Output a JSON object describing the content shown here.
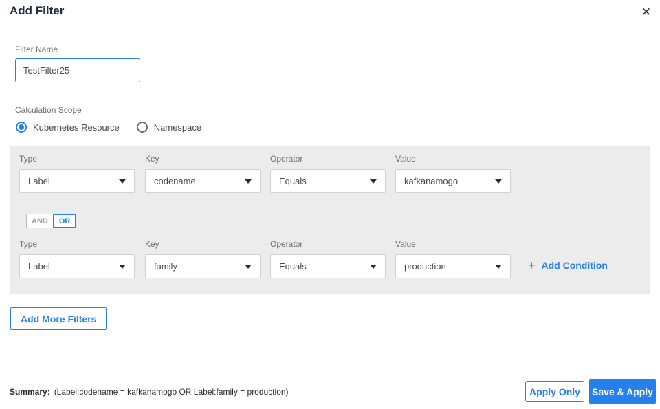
{
  "dialog": {
    "title": "Add Filter"
  },
  "filter_name": {
    "label": "Filter Name",
    "value": "TestFilter25"
  },
  "calculation_scope": {
    "label": "Calculation Scope",
    "options": [
      {
        "label": "Kubernetes Resource",
        "selected": true
      },
      {
        "label": "Namespace",
        "selected": false
      }
    ]
  },
  "conditions": {
    "columns": [
      "Type",
      "Key",
      "Operator",
      "Value"
    ],
    "rows": [
      {
        "type": "Label",
        "key": "codename",
        "operator": "Equals",
        "value": "kafkanamogo"
      },
      {
        "type": "Label",
        "key": "family",
        "operator": "Equals",
        "value": "production"
      }
    ],
    "connector": {
      "options": [
        "AND",
        "OR"
      ],
      "selected": "OR"
    },
    "add_condition": {
      "plus": "+",
      "label": "Add Condition"
    }
  },
  "add_more_filters": {
    "label": "Add More Filters"
  },
  "footer": {
    "summary_label": "Summary:",
    "summary_text": "(Label:codename = kafkanamogo OR Label:family = production)",
    "apply_only_label": "Apply Only",
    "save_apply_label": "Save & Apply"
  },
  "icons": {
    "close": "✕"
  },
  "colors": {
    "accent_blue": "#2680eb",
    "panel_gray": "#ececec",
    "title_dark": "#202e3e",
    "label_gray": "#6e6e6e"
  }
}
